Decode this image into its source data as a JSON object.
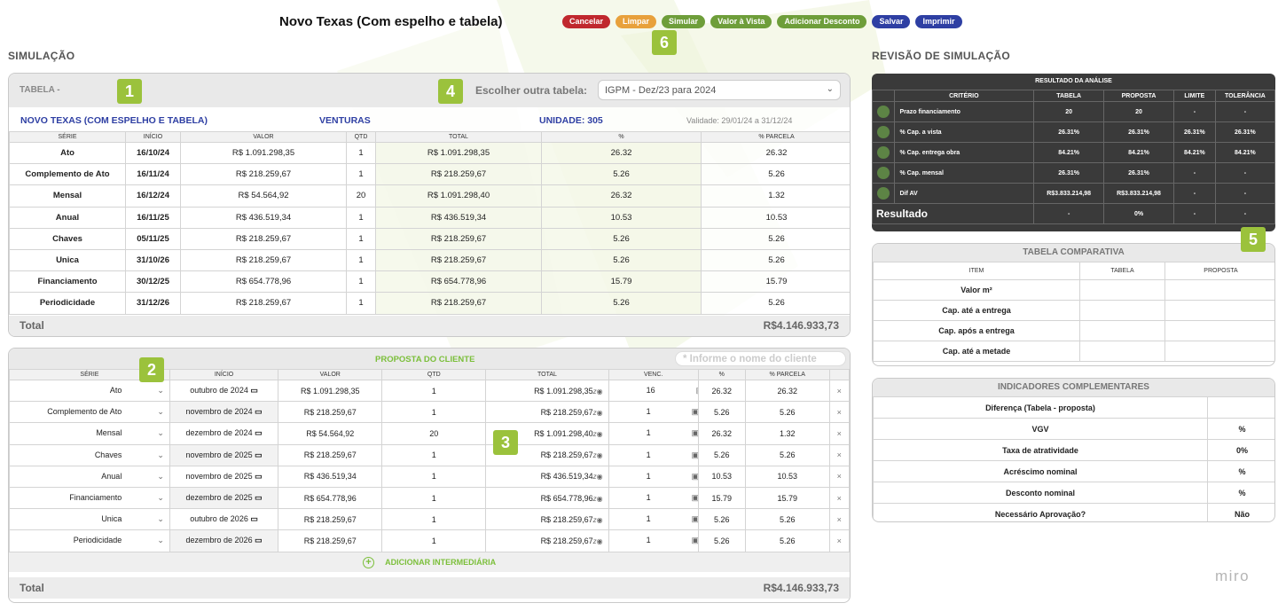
{
  "header": {
    "title": "Novo Texas (Com espelho e tabela)",
    "buttons": [
      {
        "label": "Cancelar",
        "color": "#c0282e"
      },
      {
        "label": "Limpar",
        "color": "#e8a13c"
      },
      {
        "label": "Simular",
        "color": "#6e9e3a"
      },
      {
        "label": "Valor à Vista",
        "color": "#6e9e3a"
      },
      {
        "label": "Adicionar Desconto",
        "color": "#6e9e3a"
      },
      {
        "label": "Salvar",
        "color": "#2e3fa3"
      },
      {
        "label": "Imprimir",
        "color": "#2e3fa3"
      }
    ]
  },
  "badges": [
    "1",
    "2",
    "3",
    "4",
    "5",
    "6"
  ],
  "simulacao": {
    "heading": "SIMULAÇÃO",
    "tabela_label": "TABELA -",
    "escolher_label": "Escolher outra tabela:",
    "select_value": "IGPM - Dez/23 para 2024",
    "empreendimento": "NOVO TEXAS (COM ESPELHO E TABELA)",
    "imobiliaria": "VENTURAS",
    "unidade": "UNIDADE: 305",
    "validade": "Validade: 29/01/24 a 31/12/24",
    "columns": [
      "SÉRIE",
      "INÍCIO",
      "VALOR",
      "QTD",
      "TOTAL",
      "%",
      "% PARCELA"
    ],
    "rows": [
      [
        "Ato",
        "16/10/24",
        "R$ 1.091.298,35",
        "1",
        "R$ 1.091.298,35",
        "26.32",
        "26.32"
      ],
      [
        "Complemento de Ato",
        "16/11/24",
        "R$ 218.259,67",
        "1",
        "R$ 218.259,67",
        "5.26",
        "5.26"
      ],
      [
        "Mensal",
        "16/12/24",
        "R$ 54.564,92",
        "20",
        "R$ 1.091.298,40",
        "26.32",
        "1.32"
      ],
      [
        "Anual",
        "16/11/25",
        "R$ 436.519,34",
        "1",
        "R$ 436.519,34",
        "10.53",
        "10.53"
      ],
      [
        "Chaves",
        "05/11/25",
        "R$ 218.259,67",
        "1",
        "R$ 218.259,67",
        "5.26",
        "5.26"
      ],
      [
        "Unica",
        "31/10/26",
        "R$ 218.259,67",
        "1",
        "R$ 218.259,67",
        "5.26",
        "5.26"
      ],
      [
        "Financiamento",
        "30/12/25",
        "R$ 654.778,96",
        "1",
        "R$ 654.778,96",
        "15.79",
        "15.79"
      ],
      [
        "Periodicidade",
        "31/12/26",
        "R$ 218.259,67",
        "1",
        "R$ 218.259,67",
        "5.26",
        "5.26"
      ]
    ],
    "total_label": "Total",
    "total_value": "R$4.146.933,73"
  },
  "proposta": {
    "title": "PROPOSTA DO CLIENTE",
    "client_placeholder": "* Informe o nome do cliente",
    "columns": [
      "SÉRIE",
      "INÍCIO",
      "VALOR",
      "QTD",
      "TOTAL",
      "VENC.",
      "%",
      "% PARCELA"
    ],
    "rows": [
      [
        "Ato",
        "outubro de 2024",
        "R$ 1.091.298,35",
        "1",
        "R$ 1.091.298,35",
        "16",
        "26.32",
        "26.32"
      ],
      [
        "Complemento de Ato",
        "novembro de 2024",
        "R$ 218.259,67",
        "1",
        "R$ 218.259,67",
        "1",
        "5.26",
        "5.26"
      ],
      [
        "Mensal",
        "dezembro de 2024",
        "R$ 54.564,92",
        "20",
        "R$ 1.091.298,40",
        "1",
        "26.32",
        "1.32"
      ],
      [
        "Chaves",
        "novembro de 2025",
        "R$ 218.259,67",
        "1",
        "R$ 218.259,67",
        "1",
        "5.26",
        "5.26"
      ],
      [
        "Anual",
        "novembro de 2025",
        "R$ 436.519,34",
        "1",
        "R$ 436.519,34",
        "1",
        "10.53",
        "10.53"
      ],
      [
        "Financiamento",
        "dezembro de 2025",
        "R$ 654.778,96",
        "1",
        "R$ 654.778,96",
        "1",
        "15.79",
        "15.79"
      ],
      [
        "Unica",
        "outubro de 2026",
        "R$ 218.259,67",
        "1",
        "R$ 218.259,67",
        "1",
        "5.26",
        "5.26"
      ],
      [
        "Periodicidade",
        "dezembro de 2026",
        "R$ 218.259,67",
        "1",
        "R$ 218.259,67",
        "1",
        "5.26",
        "5.26"
      ]
    ],
    "add_label": "ADICIONAR INTERMEDIÁRIA",
    "total_label": "Total",
    "total_value": "R$4.146.933,73"
  },
  "revisao": {
    "heading": "REVISÃO DE SIMULAÇÃO",
    "resultado_title": "RESULTADO DA ANÁLISE",
    "columns": [
      "CRITÉRIO",
      "TABELA",
      "PROPOSTA",
      "LIMITE",
      "TOLERÂNCIA"
    ],
    "rows": [
      [
        "Prazo financiamento",
        "20",
        "20",
        "-",
        "-"
      ],
      [
        "% Cap. a vista",
        "26.31%",
        "26.31%",
        "26.31%",
        "26.31%"
      ],
      [
        "% Cap. entrega obra",
        "84.21%",
        "84.21%",
        "84.21%",
        "84.21%"
      ],
      [
        "% Cap. mensal",
        "26.31%",
        "26.31%",
        "-",
        "-"
      ],
      [
        "Dif AV",
        "R$3.833.214,98",
        "R$3.833.214,98",
        "-",
        "-"
      ]
    ],
    "resultado_label": "Resultado",
    "resultado_values": [
      "-",
      "0%",
      "-",
      "-"
    ]
  },
  "comparativa": {
    "title": "TABELA COMPARATIVA",
    "columns": [
      "ITEM",
      "TABELA",
      "PROPOSTA"
    ],
    "rows": [
      "Valor m²",
      "Cap. até a entrega",
      "Cap. após a entrega",
      "Cap. até a metade"
    ]
  },
  "indicadores": {
    "title": "INDICADORES COMPLEMENTARES",
    "rows": [
      [
        "Diferença (Tabela - proposta)",
        ""
      ],
      [
        "VGV",
        "%"
      ],
      [
        "Taxa de atratividade",
        "0%"
      ],
      [
        "Acréscimo nominal",
        "%"
      ],
      [
        "Desconto nominal",
        "%"
      ],
      [
        "Necessário Aprovação?",
        "Não"
      ]
    ]
  },
  "watermark": "miro"
}
